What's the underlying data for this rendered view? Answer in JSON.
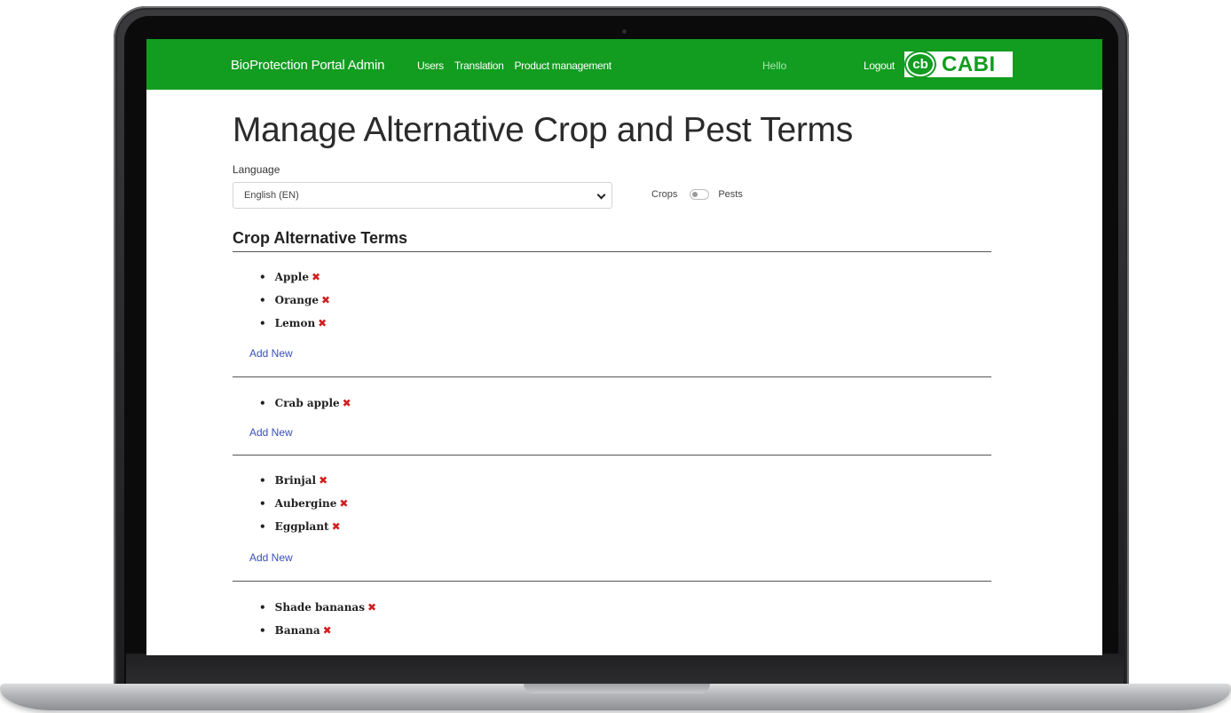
{
  "nav": {
    "brand": "BioProtection Portal Admin",
    "links": [
      "Users",
      "Translation",
      "Product management"
    ],
    "greeting": "Hello",
    "logout": "Logout",
    "logo_mark": "cb",
    "logo_text": "CABI"
  },
  "page": {
    "title": "Manage Alternative Crop and Pest Terms",
    "language_label": "Language",
    "language_value": "English (EN)",
    "toggle_left": "Crops",
    "toggle_right": "Pests",
    "section_title": "Crop Alternative Terms",
    "add_new_label": "Add New",
    "remove_glyph": "✖"
  },
  "groups": [
    {
      "terms": [
        "Apple",
        "Orange",
        "Lemon"
      ]
    },
    {
      "terms": [
        "Crab apple"
      ]
    },
    {
      "terms": [
        "Brinjal",
        "Aubergine",
        "Eggplant"
      ]
    },
    {
      "terms": [
        "Shade bananas",
        "Banana"
      ]
    }
  ],
  "colors": {
    "nav_bg": "#129c20",
    "link_color": "#3a4fb8",
    "remove_color": "#d11f1f"
  },
  "icons": {
    "select_toggle": "chevron-down-icon",
    "remove": "close-icon",
    "camera": "camera-icon"
  }
}
